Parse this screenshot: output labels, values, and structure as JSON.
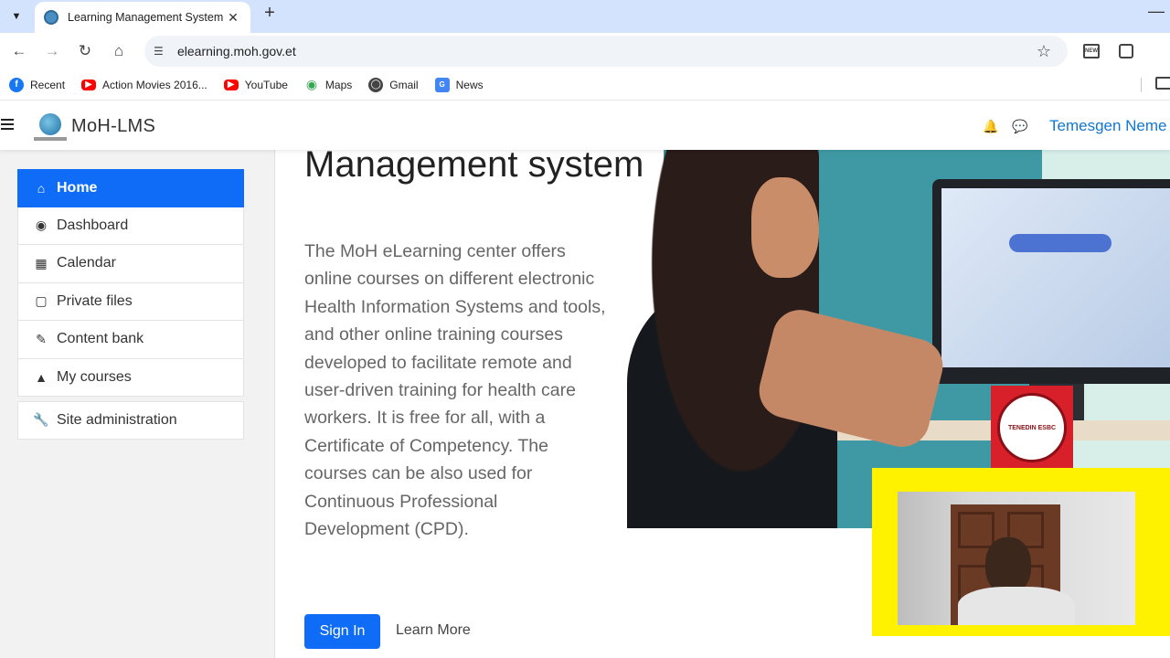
{
  "browser": {
    "tab_title": "Learning Management System",
    "url": "elearning.moh.gov.et",
    "bookmarks": [
      {
        "label": "Recent",
        "icon": "facebook-icon"
      },
      {
        "label": "Action Movies 2016...",
        "icon": "youtube-icon"
      },
      {
        "label": "YouTube",
        "icon": "youtube-icon"
      },
      {
        "label": "Maps",
        "icon": "maps-icon"
      },
      {
        "label": "Gmail",
        "icon": "globe-icon"
      },
      {
        "label": "News",
        "icon": "news-icon"
      }
    ]
  },
  "navbar": {
    "brand": "MoH-LMS",
    "user_name": "Temesgen Neme"
  },
  "drawer": {
    "items": [
      {
        "label": "Home",
        "icon": "home-icon",
        "active": true
      },
      {
        "label": "Dashboard",
        "icon": "dashboard-icon"
      },
      {
        "label": "Calendar",
        "icon": "calendar-icon"
      },
      {
        "label": "Private files",
        "icon": "file-icon"
      },
      {
        "label": "Content bank",
        "icon": "brush-icon"
      },
      {
        "label": "My courses",
        "icon": "graduation-cap-icon"
      }
    ],
    "admin_item": {
      "label": "Site administration",
      "icon": "wrench-icon"
    }
  },
  "hero": {
    "title": "Management system",
    "description": "The MoH eLearning center offers online courses on different electronic Health Information Systems and tools, and other online training courses developed to facilitate remote and user-driven training for health care workers. It is free for all, with a Certificate of Competency. The courses can be also used for Continuous Professional Development (CPD).",
    "sign_in_label": "Sign In",
    "learn_more_label": "Learn More"
  },
  "overlay": {
    "stamp_text": "TENEDIN ESBC"
  },
  "colors": {
    "primary": "#0f6cf6",
    "link": "#1177d1",
    "webcam_frame": "#fff200",
    "stamp": "#d8202b"
  }
}
